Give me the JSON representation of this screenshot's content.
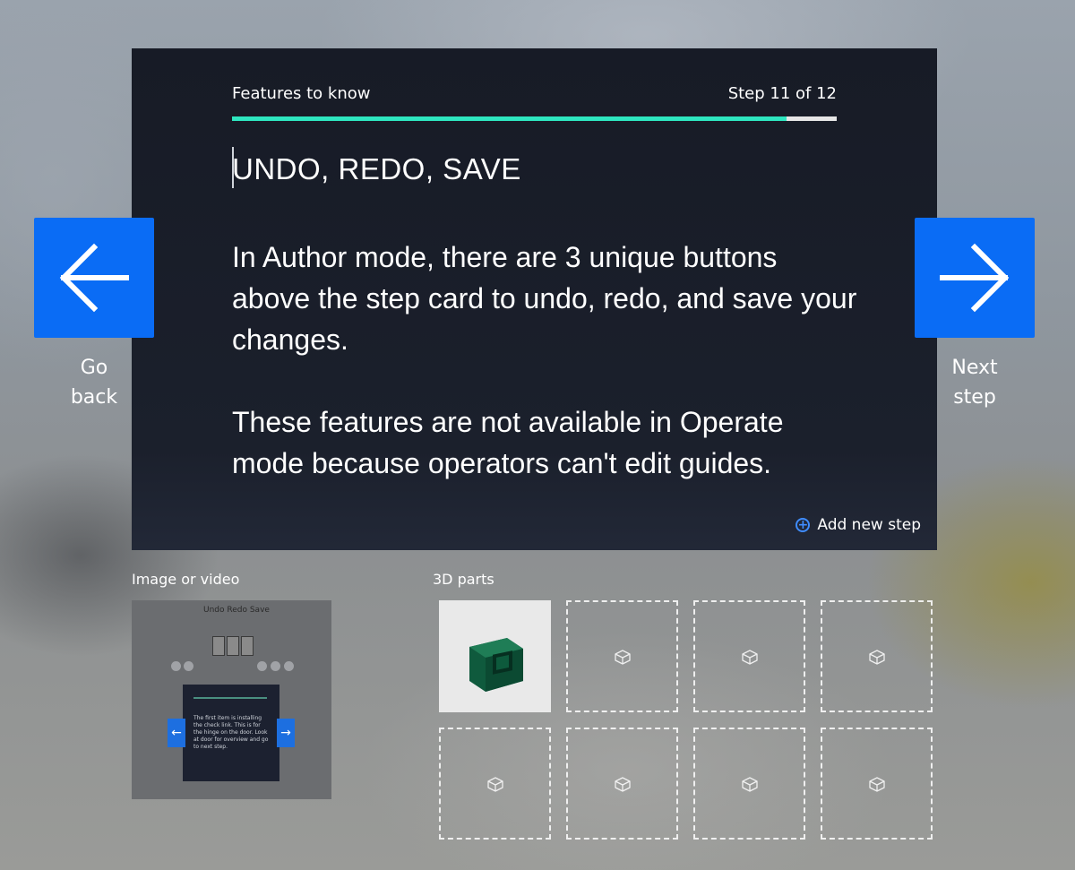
{
  "card": {
    "section": "Features to know",
    "step_label": "Step 11 of 12",
    "progress": 0.917,
    "title": "UNDO, REDO, SAVE",
    "paragraphs": [
      "In Author mode, there are 3 unique buttons above the step card to undo, redo, and save your changes.",
      "These features are not available in Operate mode because operators can't edit guides."
    ],
    "add_step_label": "Add new step"
  },
  "nav": {
    "back_line1": "Go",
    "back_line2": "back",
    "next_line1": "Next",
    "next_line2": "step"
  },
  "media": {
    "label": "Image or video",
    "thumbnail": {
      "top_labels": "Undo   Redo   Save",
      "card_text": "The first item is installing the check link. This is for the hinge on the door. Look at door for overview and go to next step."
    }
  },
  "parts": {
    "label": "3D parts",
    "slots": 8,
    "filled_slots": 1
  },
  "colors": {
    "accent_blue": "#0a6cf5",
    "progress_teal": "#2ee6c0",
    "card_bg": "#1b202c",
    "add_icon_blue": "#3f8cff"
  }
}
